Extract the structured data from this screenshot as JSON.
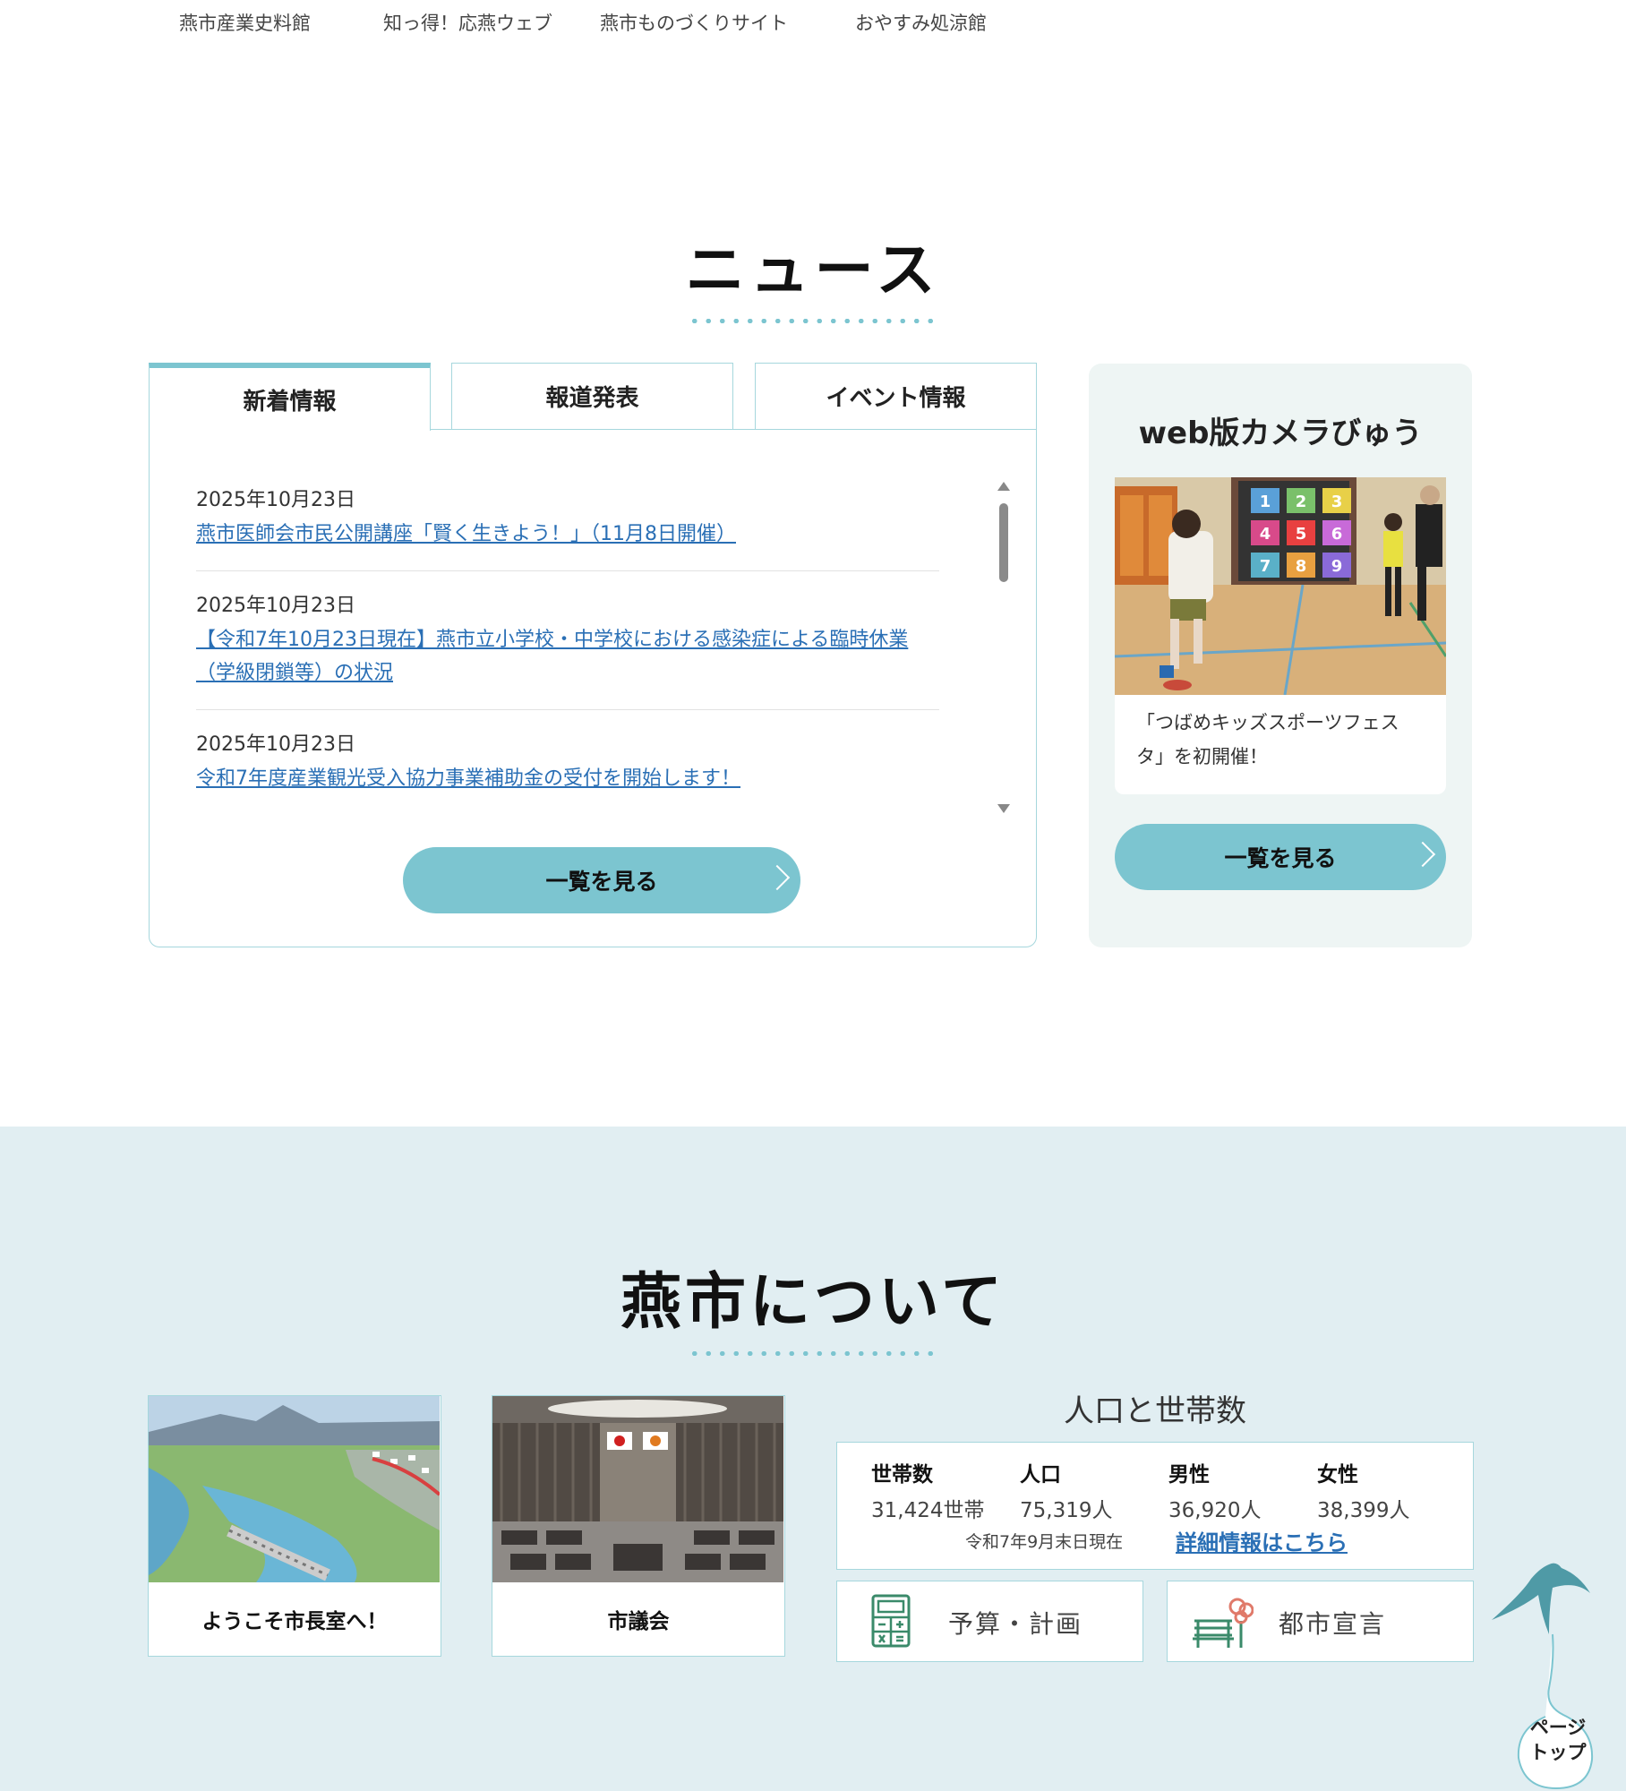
{
  "top_links": [
    "燕市産業史料館",
    "知っ得！応燕ウェブ",
    "燕市ものづくりサイト",
    "おやすみ処涼館"
  ],
  "news": {
    "title": "ニュース",
    "tabs": [
      "新着情報",
      "報道発表",
      "イベント情報"
    ],
    "items": [
      {
        "date": "2025年10月23日",
        "title": "燕市医師会市民公開講座「賢く生きよう！」（11月8日開催）"
      },
      {
        "date": "2025年10月23日",
        "title": "【令和7年10月23日現在】燕市立小学校・中学校における感染症による臨時休業（学級閉鎖等）の状況"
      },
      {
        "date": "2025年10月23日",
        "title": "令和7年度産業観光受入協力事業補助金の受付を開始します！"
      }
    ],
    "more_label": "一覧を見る"
  },
  "camera": {
    "title": "web版カメラびゅう",
    "caption": "「つばめキッズスポーツフェスタ」を初開催！",
    "more_label": "一覧を見る",
    "photo_numbers": [
      "1",
      "2",
      "3",
      "4",
      "5",
      "6",
      "7",
      "8",
      "9"
    ]
  },
  "about": {
    "title": "燕市について",
    "cards": [
      "ようこそ市長室へ！",
      "市議会"
    ],
    "population": {
      "title": "人口と世帯数",
      "columns": [
        {
          "label": "世帯数",
          "value": "31,424世帯"
        },
        {
          "label": "人口",
          "value": "75,319人"
        },
        {
          "label": "男性",
          "value": "36,920人"
        },
        {
          "label": "女性",
          "value": "38,399人"
        }
      ],
      "as_of": "令和7年9月末日現在",
      "detail_link": "詳細情報はこちら"
    },
    "links": [
      {
        "label": "予算・計画",
        "icon": "calculator-icon"
      },
      {
        "label": "都市宣言",
        "icon": "bench-tree-icon"
      }
    ]
  },
  "page_top": {
    "line1": "ページ",
    "line2": "トップ"
  },
  "colors": {
    "accent": "#7cc5d0",
    "border": "#a6d7dd",
    "link": "#2a6fb5",
    "about_bg": "#e1eef2",
    "camera_bg": "#eef5f4"
  }
}
